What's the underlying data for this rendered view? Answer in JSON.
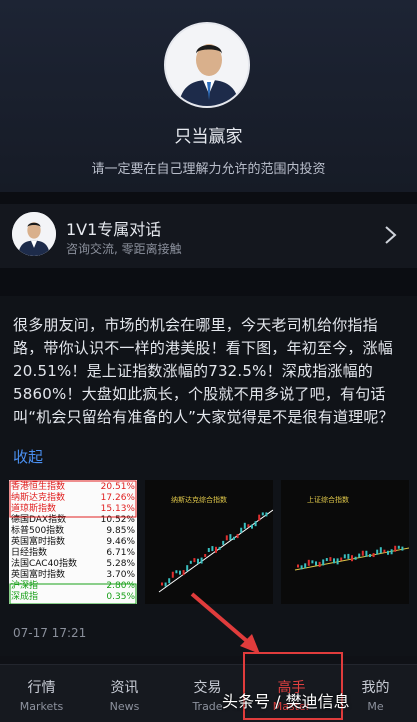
{
  "profile": {
    "name": "只当赢家",
    "notice": "请一定要在自己理解力允许的范围内投资"
  },
  "card": {
    "title": "1V1专属对话",
    "subtitle": "咨询交流, 零距离接触"
  },
  "post": {
    "text": "很多朋友问，市场的机会在哪里，今天老司机给你指指路，带你认识不一样的港美股！看下图，年初至今，涨幅20.51%！是上证指数涨幅的732.5%！深成指涨幅的5860%！大盘如此疯长，个股就不用多说了吧，有句话叫“机会只留给有准备的人”大家觉得是不是很有道理呢？",
    "collapse_label": "收起",
    "timestamp": "07-17 17:21"
  },
  "thumb_table": {
    "rows": [
      {
        "label": "香港恒生指数",
        "value": "20.51%",
        "color": "#e02020"
      },
      {
        "label": "纳斯达克指数",
        "value": "17.26%",
        "color": "#e02020"
      },
      {
        "label": "道琼斯指数",
        "value": "15.13%",
        "color": "#e02020"
      },
      {
        "label": "德国DAX指数",
        "value": "10.52%",
        "color": "#111111"
      },
      {
        "label": "标普500指数",
        "value": "9.85%",
        "color": "#111111"
      },
      {
        "label": "英国富时指数",
        "value": "9.46%",
        "color": "#111111"
      },
      {
        "label": "日经指数",
        "value": "6.71%",
        "color": "#111111"
      },
      {
        "label": "法国CAC40指数",
        "value": "5.28%",
        "color": "#111111"
      },
      {
        "label": "英国富时指数",
        "value": "3.70%",
        "color": "#111111"
      },
      {
        "label": "沪深指",
        "value": "2.80%",
        "color": "#18a018"
      },
      {
        "label": "深成指",
        "value": "0.35%",
        "color": "#18a018"
      }
    ]
  },
  "thumb_charts": [
    {
      "title": "纳斯达克综合指数"
    },
    {
      "title": "上证综合指数"
    }
  ],
  "tabs": [
    {
      "zh": "行情",
      "en": "Markets"
    },
    {
      "zh": "资讯",
      "en": "News"
    },
    {
      "zh": "交易",
      "en": "Trade"
    },
    {
      "zh": "高手",
      "en": "Master"
    },
    {
      "zh": "我的",
      "en": "Me"
    }
  ],
  "watermark": "头条号 / 樊迪信息",
  "colors": {
    "accent_blue": "#4a8ff0",
    "active_red": "#e04040"
  }
}
